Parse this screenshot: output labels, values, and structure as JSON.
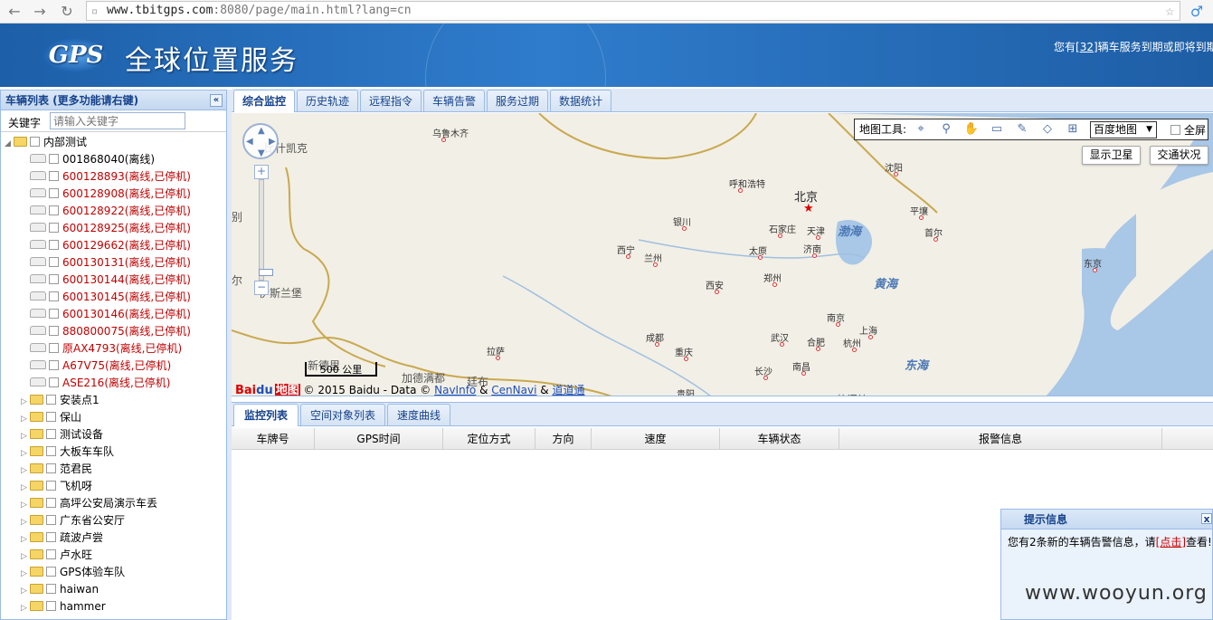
{
  "browser": {
    "url_host": "www.tbitgps.com",
    "url_rest": ":8080/page/main.html?lang=cn"
  },
  "header": {
    "logo": "GPS",
    "title": "全球位置服务",
    "notice_prefix": "您有[",
    "notice_count": "32",
    "notice_suffix": "]辆车服务到期或即将到期"
  },
  "left_panel": {
    "title": "车辆列表 (更多功能请右键)",
    "collapse": "«",
    "keyword_label": "关键字",
    "keyword_placeholder": "请输入关键字",
    "root": "内部测试",
    "vehicles": [
      "001868040(离线)",
      "600128893(离线,已停机)",
      "600128908(离线,已停机)",
      "600128922(离线,已停机)",
      "600128925(离线,已停机)",
      "600129662(离线,已停机)",
      "600130131(离线,已停机)",
      "600130144(离线,已停机)",
      "600130145(离线,已停机)",
      "600130146(离线,已停机)",
      "880800075(离线,已停机)",
      "原AX4793(离线,已停机)",
      "A67V75(离线,已停机)",
      "ASE216(离线,已停机)"
    ],
    "groups": [
      "安装点1",
      "保山",
      "测试设备",
      "大板车车队",
      "范君民",
      "飞机呀",
      "高坪公安局演示车丢",
      "广东省公安厅",
      "疏波卢尝",
      "卢水旺",
      "GPS体验车队",
      "haiwan",
      "hammer"
    ]
  },
  "tabs": [
    "综合监控",
    "历史轨迹",
    "远程指令",
    "车辆告警",
    "服务过期",
    "数据统计"
  ],
  "map": {
    "tools_label": "地图工具:",
    "map_type": "百度地图",
    "fullscreen": "全屏",
    "satellite_btn": "显示卫星",
    "traffic_btn": "交通状况",
    "scale": "500 公里",
    "copyright": "© 2015 Baidu - Data ©",
    "navinfo": "NavInfo",
    "amp": "&",
    "citynavi": "CenNavi",
    "amp2": "&",
    "daodaotong": "道道通",
    "baidu_logo_a": "Bai",
    "baidu_logo_b": "du",
    "baidu_logo_c": "地图",
    "cities": [
      "乌鲁木齐",
      "呼和浩特",
      "北京",
      "沈阳",
      "天津",
      "石家庄",
      "银川",
      "太原",
      "西宁",
      "兰州",
      "济南",
      "郑州",
      "西安",
      "平壤",
      "首尔",
      "东京",
      "南京",
      "上海",
      "合肥",
      "武汉",
      "杭州",
      "成都",
      "重庆",
      "拉萨",
      "长沙",
      "南昌",
      "贵阳"
    ],
    "seas": [
      "渤海",
      "黄海",
      "东海"
    ],
    "edge_labels": [
      "比什凯克",
      "别",
      "尔",
      "伊斯兰堡",
      "新德里",
      "加德满都",
      "廷布",
      "苏门答"
    ]
  },
  "bottom_tabs": [
    "监控列表",
    "空间对象列表",
    "速度曲线"
  ],
  "grid_columns": [
    "车牌号",
    "GPS时间",
    "定位方式",
    "方向",
    "速度",
    "车辆状态",
    "报警信息"
  ],
  "popup": {
    "title": "提示信息",
    "close": "x",
    "text_prefix": "您有2条新的车辆告警信息，请",
    "link": "[点击]",
    "text_suffix": "查看!"
  },
  "watermark": "www.wooyun.org"
}
